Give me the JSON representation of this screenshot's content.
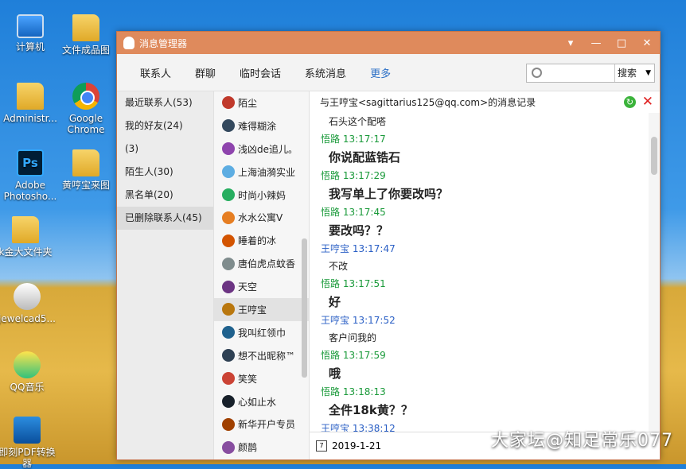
{
  "desktop": {
    "icons": [
      {
        "label": "计算机"
      },
      {
        "label": "文件成品图"
      },
      {
        "label": "Administr..."
      },
      {
        "label": "Google Chrome"
      },
      {
        "label": "Adobe Photosho..."
      },
      {
        "label": "黄哼宝来图"
      },
      {
        "label": "k金大文件夹"
      },
      {
        "label": "jewelcad5..."
      },
      {
        "label": "QQ音乐"
      },
      {
        "label": "即刻PDF转换器"
      }
    ],
    "watermark": "大家坛@知足常乐077"
  },
  "window": {
    "title": "消息管理器",
    "controls": {
      "menu": "▾",
      "minimize": "—",
      "maximize": "□",
      "close": "✕"
    }
  },
  "toolbar": {
    "tabs": [
      "联系人",
      "群聊",
      "临时会话",
      "系统消息",
      "更多"
    ],
    "search_placeholder": "",
    "search_button": "搜索"
  },
  "groups": [
    {
      "label": "最近联系人(53)"
    },
    {
      "label": "我的好友(24)"
    },
    {
      "label": "(3)"
    },
    {
      "label": "陌生人(30)"
    },
    {
      "label": "黑名单(20)"
    },
    {
      "label": "已删除联系人(45)"
    }
  ],
  "contacts": [
    {
      "name": "陌尘",
      "color": "#c0392b"
    },
    {
      "name": "难得糊涂",
      "color": "#34495e"
    },
    {
      "name": "浅凶de追儿。",
      "color": "#8e44ad"
    },
    {
      "name": "上海油漪实业",
      "color": "#5dade2"
    },
    {
      "name": "时尚小辣妈",
      "color": "#27ae60"
    },
    {
      "name": "水水公寓V",
      "color": "#e67e22"
    },
    {
      "name": "睡着的冰",
      "color": "#d35400"
    },
    {
      "name": "唐伯虎点蚊香",
      "color": "#7f8c8d"
    },
    {
      "name": "天空",
      "color": "#6c3483"
    },
    {
      "name": "王哼宝",
      "color": "#b9770e"
    },
    {
      "name": "我叫红领巾",
      "color": "#1f618d"
    },
    {
      "name": "想不出昵称™",
      "color": "#2e4053"
    },
    {
      "name": "笑笑",
      "color": "#cb4335"
    },
    {
      "name": "心如止水",
      "color": "#17202a"
    },
    {
      "name": "新华开户专员",
      "color": "#a04000"
    },
    {
      "name": "颜鹊",
      "color": "#884ea0"
    }
  ],
  "conversation": {
    "header": "与王哼宝<sagittarius125@qq.com>的消息记录",
    "messages": [
      {
        "kind": "text",
        "text": "石头这个配嗒",
        "big": false
      },
      {
        "kind": "sender",
        "sender": "悟路",
        "time": "13:17:17",
        "color": "g"
      },
      {
        "kind": "text",
        "text": "你说配蓝锆石",
        "big": true
      },
      {
        "kind": "sender",
        "sender": "悟路",
        "time": "13:17:29",
        "color": "g"
      },
      {
        "kind": "text",
        "text": "我写单上了你要改吗？",
        "big": true
      },
      {
        "kind": "sender",
        "sender": "悟路",
        "time": "13:17:45",
        "color": "g"
      },
      {
        "kind": "text",
        "text": "要改吗？？",
        "big": true
      },
      {
        "kind": "sender",
        "sender": "王哼宝",
        "time": "13:17:47",
        "color": "b"
      },
      {
        "kind": "text",
        "text": "不改",
        "big": false
      },
      {
        "kind": "sender",
        "sender": "悟路",
        "time": "13:17:51",
        "color": "g"
      },
      {
        "kind": "text",
        "text": "好",
        "big": true
      },
      {
        "kind": "sender",
        "sender": "王哼宝",
        "time": "13:17:52",
        "color": "b"
      },
      {
        "kind": "text",
        "text": "客户问我的",
        "big": false
      },
      {
        "kind": "sender",
        "sender": "悟路",
        "time": "13:17:59",
        "color": "g"
      },
      {
        "kind": "text",
        "text": "哦",
        "big": true
      },
      {
        "kind": "sender",
        "sender": "悟路",
        "time": "13:18:13",
        "color": "g"
      },
      {
        "kind": "text",
        "text": "全件18k黄？？",
        "big": true
      },
      {
        "kind": "sender",
        "sender": "王哼宝",
        "time": "13:38:12",
        "color": "b"
      }
    ],
    "date": "2019-1-21",
    "calendar_glyph": "7"
  }
}
